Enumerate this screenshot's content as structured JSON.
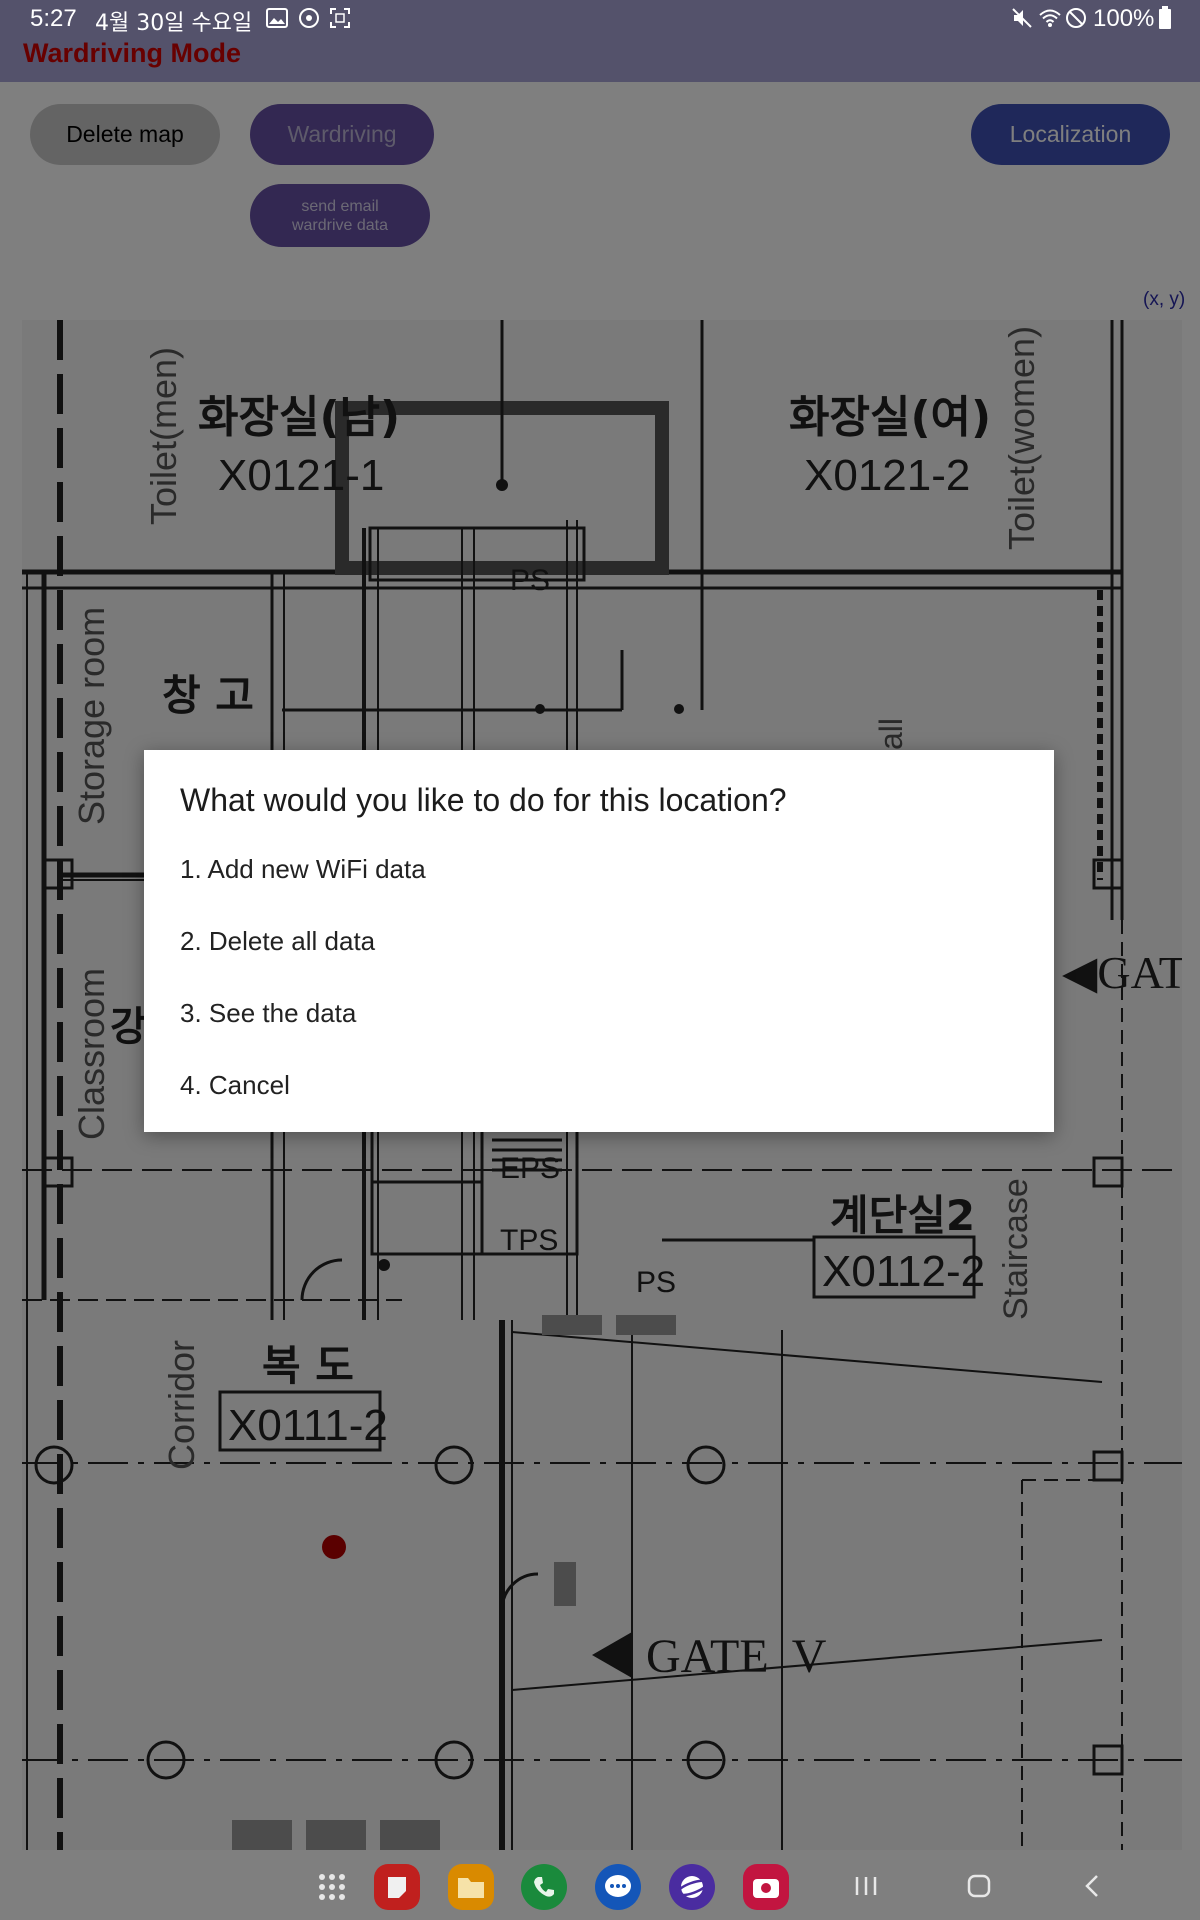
{
  "status_bar": {
    "time": "5:27",
    "date": "4월 30일 수요일",
    "battery": "100%"
  },
  "app": {
    "title": "Wardriving Mode",
    "buttons": {
      "delete_map": "Delete map",
      "wardriving": "Wardriving",
      "localization": "Localization",
      "send_email_line1": "send email",
      "send_email_line2": "wardrive data"
    },
    "coord_label": "(x, y)"
  },
  "floorplan": {
    "labels": {
      "toilet_men": "Toilet(men)",
      "toilet_women": "Toilet(women)",
      "toilet_men_kr": "화장실(남)",
      "toilet_women_kr": "화장실(여)",
      "room_x0121_1": "X0121-1",
      "room_x0121_2": "X0121-2",
      "ps": "PS",
      "storage_room": "Storage room",
      "storage_kr": "창 고",
      "classroom": "Classroom",
      "classroom_kr": "강",
      "gate_partial": "◀GAT",
      "eps": "EPS",
      "tps": "TPS",
      "ps2": "PS",
      "staircase_kr": "계단실2",
      "room_x0112_2": "X0112-2",
      "staircase": "Staircase",
      "corridor": "Corridor",
      "corridor_kr": "복 도",
      "room_x0111_2": "X0111-2",
      "gate_v": "GATE  V",
      "hall_partial": "all"
    }
  },
  "dialog": {
    "title": "What would you like to do for this location?",
    "options": [
      "1. Add new WiFi data",
      "2. Delete all data",
      "3. See the data",
      "4. Cancel"
    ]
  },
  "dock": {
    "apps": [
      "apps-grid-icon",
      "memo-app-icon",
      "files-app-icon",
      "phone-app-icon",
      "messages-app-icon",
      "internet-app-icon",
      "camera-app-icon"
    ]
  },
  "colors": {
    "app_title": "#d00000",
    "wardriving_button": "#6750a4",
    "localization_button": "#3f51b5",
    "marker": "#b40000"
  }
}
